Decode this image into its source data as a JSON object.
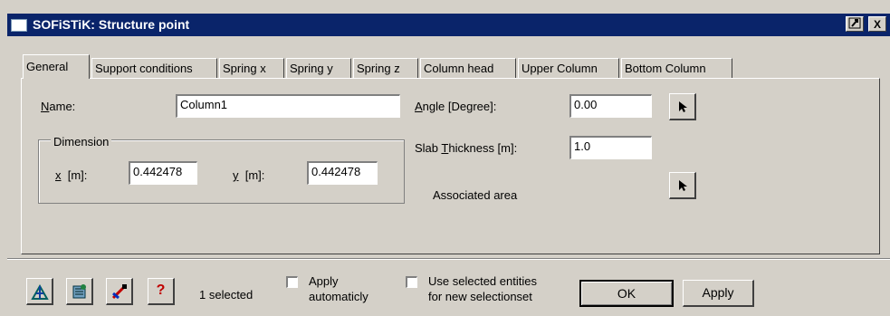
{
  "window": {
    "title": "SOFiSTiK: Structure point",
    "title_buttons": {
      "pin_icon": "pin-icon",
      "close_glyph": "X"
    }
  },
  "tabs": [
    {
      "label": "General",
      "active": true
    },
    {
      "label": "Support conditions",
      "active": false
    },
    {
      "label": "Spring x",
      "active": false
    },
    {
      "label": "Spring y",
      "active": false
    },
    {
      "label": "Spring z",
      "active": false
    },
    {
      "label": "Column head",
      "active": false
    },
    {
      "label": "Upper Column",
      "active": false
    },
    {
      "label": "Bottom Column",
      "active": false
    }
  ],
  "general": {
    "name_label": "Name:",
    "name_value": "Column1",
    "dimension_title": "Dimension",
    "x_label": "x  [m]:",
    "x_value": "0.442478",
    "y_label": "y  [m]:",
    "y_value": "0.442478",
    "angle_label": "Angle [Degree]:",
    "angle_value": "0.00",
    "slab_label": "Slab Thickness [m]:",
    "slab_value": "1.0",
    "associated_area_label": "Associated area"
  },
  "footer": {
    "icons": [
      "edit-structure-icon",
      "settings-icon",
      "pick-icon",
      "help-icon"
    ],
    "help_glyph": "?",
    "selected_text": "1  selected",
    "apply_auto_line1": "Apply",
    "apply_auto_line2": "automaticly",
    "use_selected_line1": "Use selected entities",
    "use_selected_line2": "for new selectionset",
    "ok_label": "OK",
    "apply_label": "Apply"
  },
  "colors": {
    "titlebar": "#0a246a",
    "face": "#d4d0c8"
  }
}
